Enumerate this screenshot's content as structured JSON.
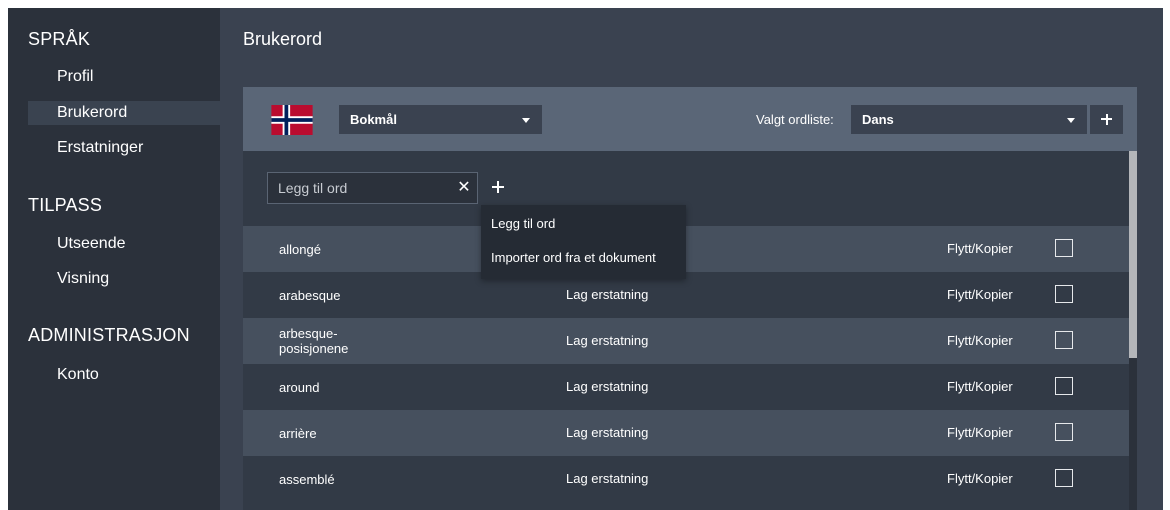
{
  "sidebar": {
    "section1": "SPRÅK",
    "items1": [
      "Profil",
      "Brukerord",
      "Erstatninger"
    ],
    "section2": "TILPASS",
    "items2": [
      "Utseende",
      "Visning"
    ],
    "section3": "ADMINISTRASJON",
    "items3": [
      "Konto"
    ],
    "active": "Brukerord"
  },
  "main": {
    "title": "Brukerord",
    "language_select": "Bokmål",
    "list_label": "Valgt ordliste:",
    "list_select": "Dans",
    "add_list_icon": "plus-icon",
    "search_placeholder": "Legg til ord",
    "clear_icon": "close-icon",
    "add_icon": "plus-icon",
    "dropdown": [
      "Legg til ord",
      "Importer ord fra et dokument"
    ],
    "rows": [
      {
        "word": "allongé",
        "replace": "",
        "move": "Flytt/Kopier"
      },
      {
        "word": "arabesque",
        "replace": "Lag erstatning",
        "move": "Flytt/Kopier"
      },
      {
        "word": "arbesque-posisjonene",
        "replace": "Lag erstatning",
        "move": "Flytt/Kopier"
      },
      {
        "word": "around",
        "replace": "Lag erstatning",
        "move": "Flytt/Kopier"
      },
      {
        "word": "arrière",
        "replace": "Lag erstatning",
        "move": "Flytt/Kopier"
      },
      {
        "word": "assemblé",
        "replace": "Lag erstatning",
        "move": "Flytt/Kopier"
      }
    ]
  },
  "colors": {
    "sidebar_bg": "#2b313b",
    "main_bg": "#3a4250",
    "panel_header_bg": "#5a6677",
    "row_alt_bg": "#46505e",
    "dropdown_bg": "#252b34",
    "flag_red": "#ba0c2f",
    "flag_blue": "#00205b"
  }
}
